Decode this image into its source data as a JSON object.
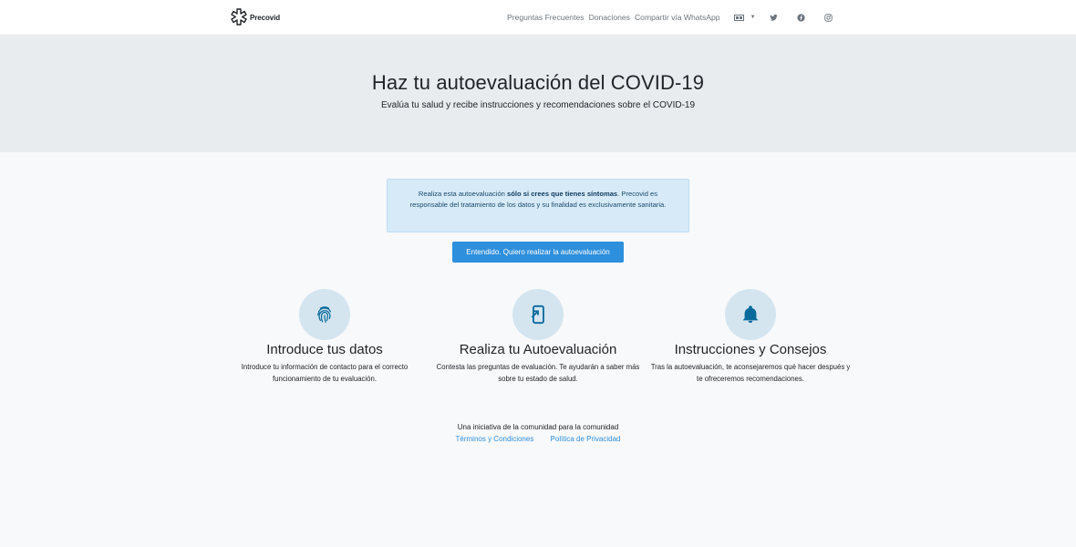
{
  "navbar": {
    "brand_name": "Precovid",
    "links": [
      "Preguntas Frecuentes",
      "Donaciones",
      "Compartir vía WhatsApp"
    ],
    "language_icon": "flag-icon",
    "social_icons": [
      "twitter-icon",
      "facebook-icon",
      "instagram-icon"
    ]
  },
  "hero": {
    "title": "Haz tu autoevaluación del COVID-19",
    "subtitle": "Evalúa tu salud y recibe instrucciones y recomendaciones sobre el COVID-19"
  },
  "alert": {
    "prefix": "Realiza esta autoevaluación ",
    "emphasis": "sólo si crees que tienes síntomas",
    "suffix": ". Precovid es responsable del tratamiento de los datos y su finalidad es exclusivamente sanitaria."
  },
  "cta_label": "Entendido. Quiero realizar la autoevaluación",
  "features": [
    {
      "icon": "fingerprint-icon",
      "title": "Introduce tus datos",
      "text": "Introduce tu información de contacto para el correcto funcionamiento de tu evaluación."
    },
    {
      "icon": "mobile-icon",
      "title": "Realiza tu Autoevaluación",
      "text": "Contesta las preguntas de evaluación. Te ayudarán a saber más sobre tu estado de salud."
    },
    {
      "icon": "bell-icon",
      "title": "Instrucciones y Consejos",
      "text": "Tras la autoevaluación, te aconsejaremos qué hacer después y te ofreceremos recomendaciones."
    }
  ],
  "footer": {
    "tagline": "Una iniciativa de la comunidad para la comunidad",
    "links": [
      "Términos y Condiciones",
      "Política de Privacidad"
    ]
  },
  "colors": {
    "accent": "#2e8fdc",
    "icon_dark": "#0b6a9c",
    "hero_bg": "#e9ecef",
    "alert_bg": "#d6eaf8"
  }
}
